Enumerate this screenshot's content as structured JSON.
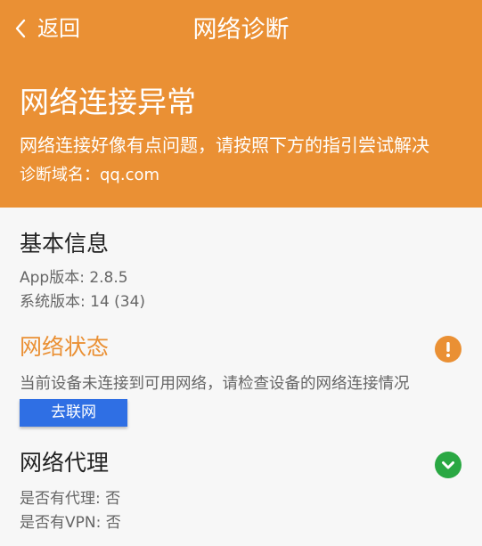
{
  "nav": {
    "back_label": "返回",
    "title": "网络诊断"
  },
  "header": {
    "status_title": "网络连接异常",
    "status_message": "网络连接好像有点问题，请按照下方的指引尝试解决",
    "domain_line": "诊断域名：qq.com"
  },
  "basic_info": {
    "title": "基本信息",
    "app_version": "App版本: 2.8.5",
    "system_version": "系统版本: 14 (34)"
  },
  "network_status": {
    "title": "网络状态",
    "message": "当前设备未连接到可用网络，请检查设备的网络连接情况",
    "button_label": "去联网",
    "status_icon": "warning-icon"
  },
  "network_proxy": {
    "title": "网络代理",
    "proxy": "是否有代理: 否",
    "vpn": "是否有VPN: 否",
    "status_icon": "check-icon"
  },
  "colors": {
    "header_bg": "#ea9034",
    "warning": "#ea9034",
    "success": "#2aa843",
    "button": "#2f6fe4",
    "background": "#f7f7f7"
  }
}
